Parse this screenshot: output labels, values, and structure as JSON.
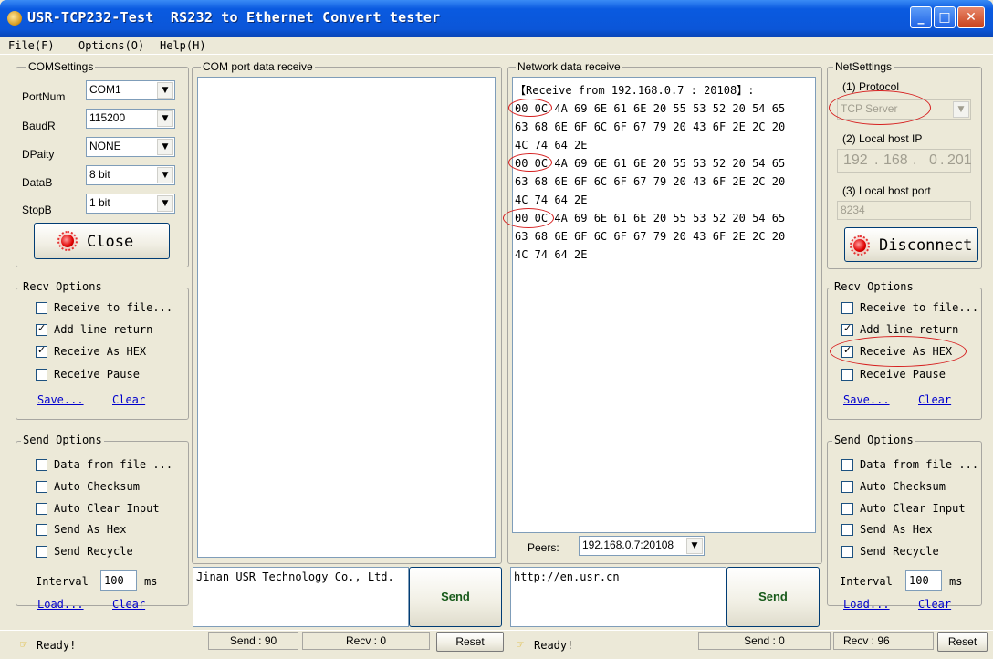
{
  "window": {
    "title": "USR-TCP232-Test  RS232 to Ethernet Convert tester"
  },
  "menu": [
    "File(F)",
    "Options(O)",
    "Help(H)"
  ],
  "com_settings": {
    "title": "COMSettings",
    "rows": [
      {
        "label": "PortNum",
        "value": "COM1"
      },
      {
        "label": "BaudR",
        "value": "115200"
      },
      {
        "label": "DPaity",
        "value": "NONE"
      },
      {
        "label": "DataB",
        "value": "8 bit"
      },
      {
        "label": "StopB",
        "value": "1 bit"
      }
    ],
    "close_label": "Close"
  },
  "left_recv": {
    "title": "Recv Options",
    "options": [
      {
        "label": "Receive to file...",
        "checked": false
      },
      {
        "label": "Add line return",
        "checked": true
      },
      {
        "label": "Receive As HEX",
        "checked": true
      },
      {
        "label": "Receive Pause",
        "checked": false
      }
    ],
    "save": "Save...",
    "clear": "Clear"
  },
  "left_send": {
    "title": "Send Options",
    "options": [
      {
        "label": "Data from file ...",
        "checked": false
      },
      {
        "label": "Auto Checksum",
        "checked": false
      },
      {
        "label": "Auto Clear Input",
        "checked": false
      },
      {
        "label": "Send As Hex",
        "checked": false
      },
      {
        "label": "Send Recycle",
        "checked": false
      }
    ],
    "interval_label": "Interval",
    "interval_value": "100",
    "interval_unit": "ms",
    "load": "Load...",
    "clear": "Clear"
  },
  "com_receive": {
    "title": "COM port data receive",
    "content": ""
  },
  "network_receive": {
    "title": "Network data receive",
    "lines": [
      "【Receive from 192.168.0.7 : 20108】:",
      "00 0C 4A 69 6E 61 6E 20 55 53 52 20 54 65",
      "63 68 6E 6F 6C 6F 67 79 20 43 6F 2E 2C 20",
      "4C 74 64 2E",
      "00 0C 4A 69 6E 61 6E 20 55 53 52 20 54 65",
      "63 68 6E 6F 6C 6F 67 79 20 43 6F 2E 2C 20",
      "4C 74 64 2E",
      "00 0C 4A 69 6E 61 6E 20 55 53 52 20 54 65",
      "63 68 6E 6F 6C 6F 67 79 20 43 6F 2E 2C 20",
      "4C 74 64 2E"
    ],
    "peers_label": "Peers:",
    "peers_value": "192.168.0.7:20108"
  },
  "com_send": {
    "text": "Jinan USR Technology Co., Ltd.",
    "send": "Send"
  },
  "net_send": {
    "text": "http://en.usr.cn",
    "send": "Send"
  },
  "net_settings": {
    "title": "NetSettings",
    "protocol_label": "(1) Protocol",
    "protocol_value": "TCP Server",
    "ip_label": "(2) Local host IP",
    "ip": [
      "192",
      "168",
      "0",
      "201"
    ],
    "port_label": "(3) Local host port",
    "port_value": "8234",
    "disconnect_label": "Disconnect"
  },
  "right_recv": {
    "title": "Recv Options",
    "options": [
      {
        "label": "Receive to file...",
        "checked": false
      },
      {
        "label": "Add line return",
        "checked": true
      },
      {
        "label": "Receive As HEX",
        "checked": true
      },
      {
        "label": "Receive Pause",
        "checked": false
      }
    ],
    "save": "Save...",
    "clear": "Clear"
  },
  "right_send": {
    "title": "Send Options",
    "options": [
      {
        "label": "Data from file ...",
        "checked": false
      },
      {
        "label": "Auto Checksum",
        "checked": false
      },
      {
        "label": "Auto Clear Input",
        "checked": false
      },
      {
        "label": "Send As Hex",
        "checked": false
      },
      {
        "label": "Send Recycle",
        "checked": false
      }
    ],
    "interval_label": "Interval",
    "interval_value": "100",
    "interval_unit": "ms",
    "load": "Load...",
    "clear": "Clear"
  },
  "status": {
    "com_ready": "Ready!",
    "com_send": "Send : 90",
    "com_recv": "Recv : 0",
    "com_reset": "Reset",
    "net_ready": "Ready!",
    "net_send": "Send : 0",
    "net_recv": "Recv : 96",
    "net_reset": "Reset"
  },
  "colors": {
    "title_blue": "#0b56d8",
    "annotation_red": "#d62020",
    "led_red": "#e00000"
  }
}
